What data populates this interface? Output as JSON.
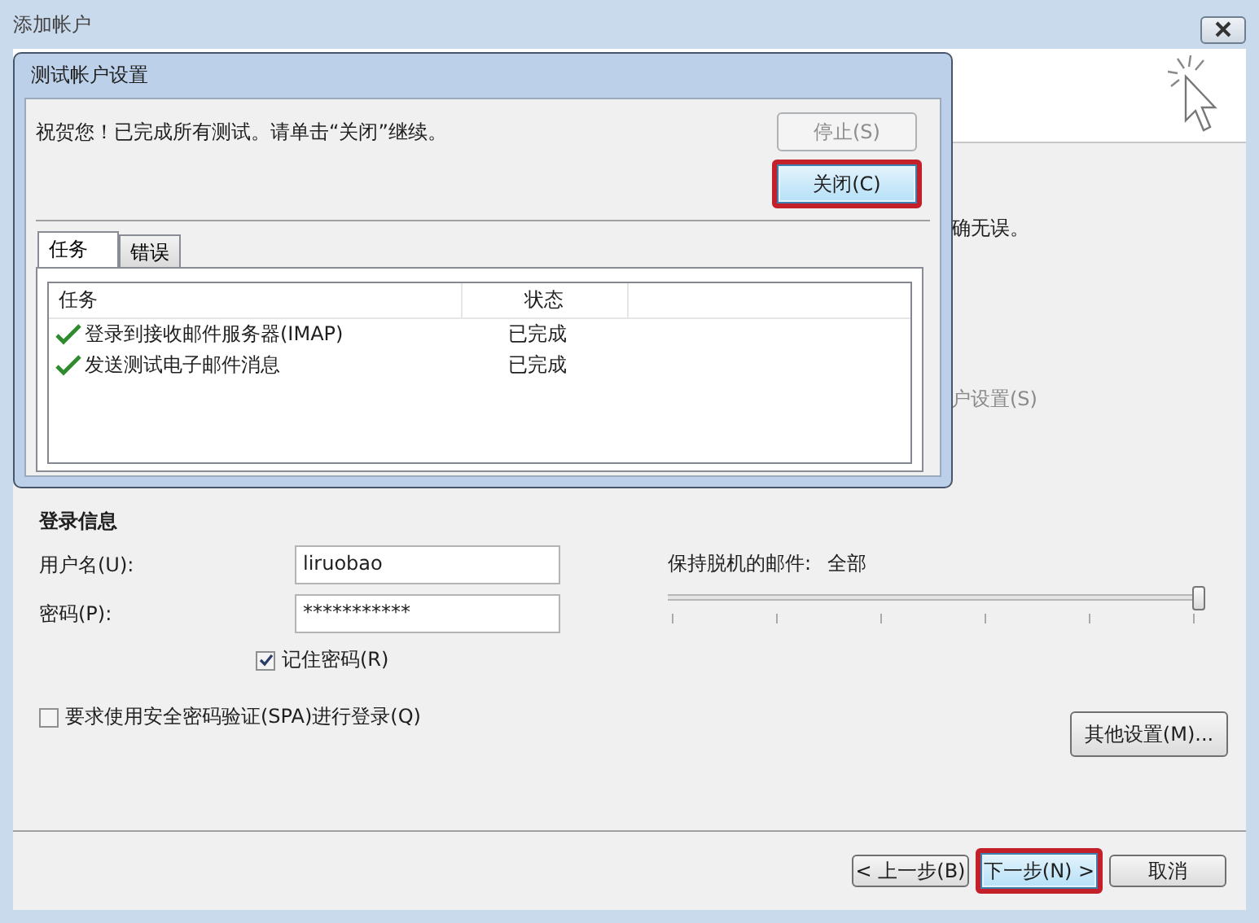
{
  "window": {
    "title": "添加帐户"
  },
  "behind_texts": [
    {
      "text": "确无误。",
      "disabled": false
    },
    {
      "text": "户设置(S)",
      "disabled": true
    }
  ],
  "login": {
    "heading": "登录信息",
    "fields": [
      {
        "label": "用户名(U):",
        "value": "liruobao"
      },
      {
        "label": "密码(P):",
        "value": "***********"
      }
    ],
    "remember": {
      "label": "记住密码(R)",
      "checked": true
    },
    "spa": {
      "label": "要求使用安全密码验证(SPA)进行登录(Q)",
      "checked": false
    }
  },
  "offline": {
    "label": "保持脱机的邮件:",
    "value": "全部",
    "level": 1
  },
  "more_settings": "其他设置(M)...",
  "nav_buttons": [
    {
      "label": "< 上一步(B)",
      "highlighted": false
    },
    {
      "label": "下一步(N) >",
      "highlighted": true
    },
    {
      "label": "取消",
      "highlighted": false
    }
  ],
  "dialog": {
    "title": "测试帐户设置",
    "message": "祝贺您！已完成所有测试。请单击“关闭”继续。",
    "buttons": [
      {
        "label": "停止(S)",
        "disabled": true,
        "highlighted": false
      },
      {
        "label": "关闭(C)",
        "disabled": false,
        "highlighted": true
      }
    ],
    "tabs": [
      {
        "label": "任务",
        "selected": true
      },
      {
        "label": "错误",
        "selected": false
      }
    ],
    "columns": [
      "任务",
      "状态"
    ],
    "rows": [
      {
        "task": "登录到接收邮件服务器(IMAP)",
        "status": "已完成",
        "done": true
      },
      {
        "task": "发送测试电子邮件消息",
        "status": "已完成",
        "done": true
      }
    ]
  }
}
